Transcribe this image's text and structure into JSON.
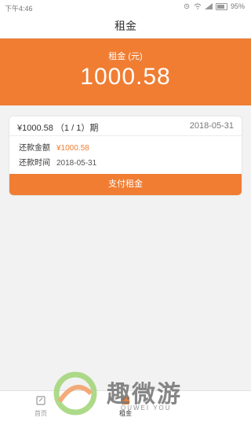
{
  "status_bar": {
    "time": "下午4:46",
    "battery": "95%"
  },
  "nav": {
    "title": "租金"
  },
  "header": {
    "label": "租金 (元)",
    "amount": "1000.58"
  },
  "bill": {
    "amount_period": "¥1000.58 （1 / 1）期",
    "date": "2018-05-31",
    "repay_amount_label": "还款金额",
    "repay_amount_value": "¥1000.58",
    "repay_time_label": "还款时间",
    "repay_time_value": "2018-05-31",
    "pay_button_label": "支付租金"
  },
  "tabs": [
    {
      "label": "首页"
    },
    {
      "label": "租金"
    }
  ],
  "watermark": {
    "title": "趣微游",
    "subtitle": "QUWEI YOU"
  },
  "colors": {
    "accent": "#f07d32"
  }
}
